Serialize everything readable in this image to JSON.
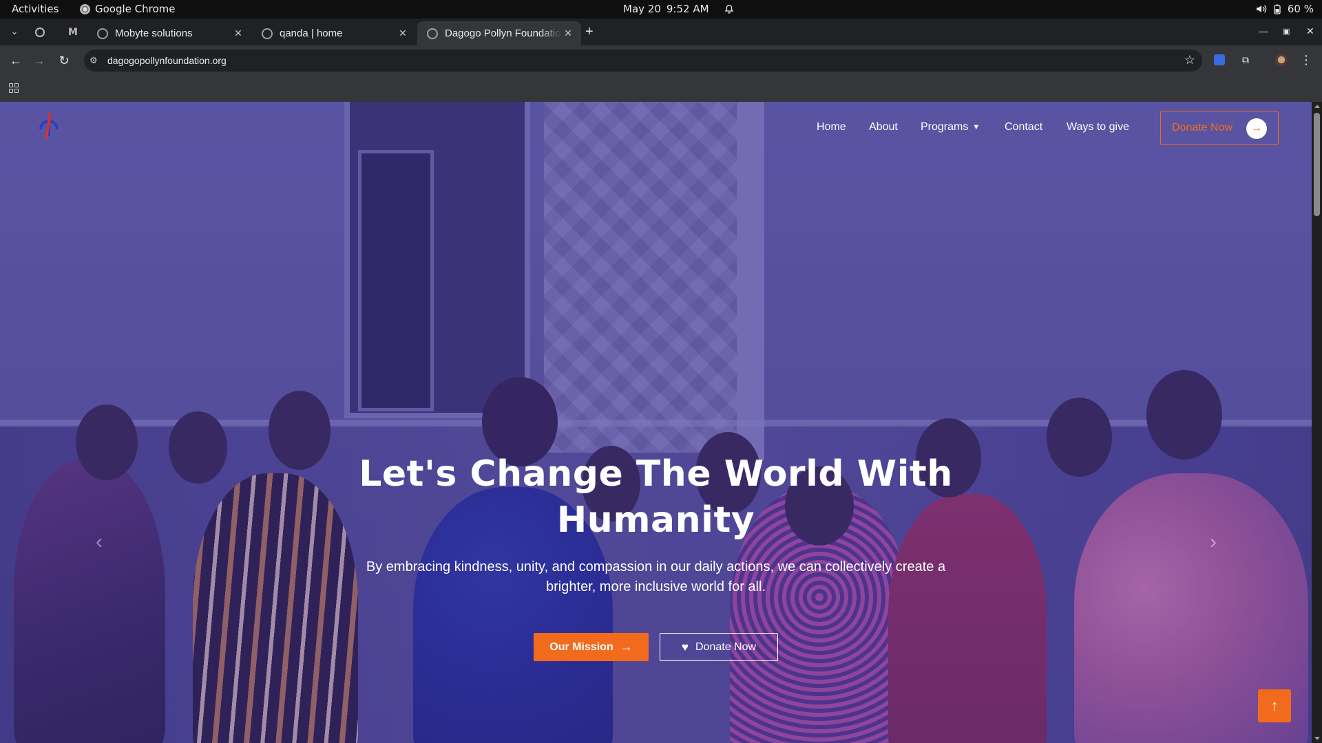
{
  "system": {
    "activities": "Activities",
    "app_name": "Google Chrome",
    "date": "May 20",
    "time": "9:52 AM",
    "battery": "60 %"
  },
  "browser": {
    "tabs": [
      {
        "title": "Mobyte solutions"
      },
      {
        "title": "qanda | home"
      },
      {
        "title": "Dagogo Pollyn Foundation"
      }
    ],
    "new_tab": "+",
    "url": "dagogopollynfoundation.org"
  },
  "site": {
    "nav": {
      "home": "Home",
      "about": "About",
      "programs": "Programs",
      "contact": "Contact",
      "ways_to_give": "Ways to give"
    },
    "donate_top": "Donate Now",
    "hero": {
      "title": "Let's Change The World With Humanity",
      "subtitle": "By embracing kindness, unity, and compassion in our daily actions, we can collectively create a brighter, more inclusive world for all.",
      "btn_mission": "Our Mission",
      "btn_donate": "Donate Now"
    },
    "colors": {
      "accent": "#f26b1d",
      "overlay": "#37288c"
    }
  },
  "icons": {
    "close": "close-icon",
    "back": "back-arrow-icon",
    "forward": "forward-arrow-icon",
    "reload": "reload-icon",
    "star": "bookmark-star-icon",
    "scroll_top": "arrow-up-icon"
  }
}
